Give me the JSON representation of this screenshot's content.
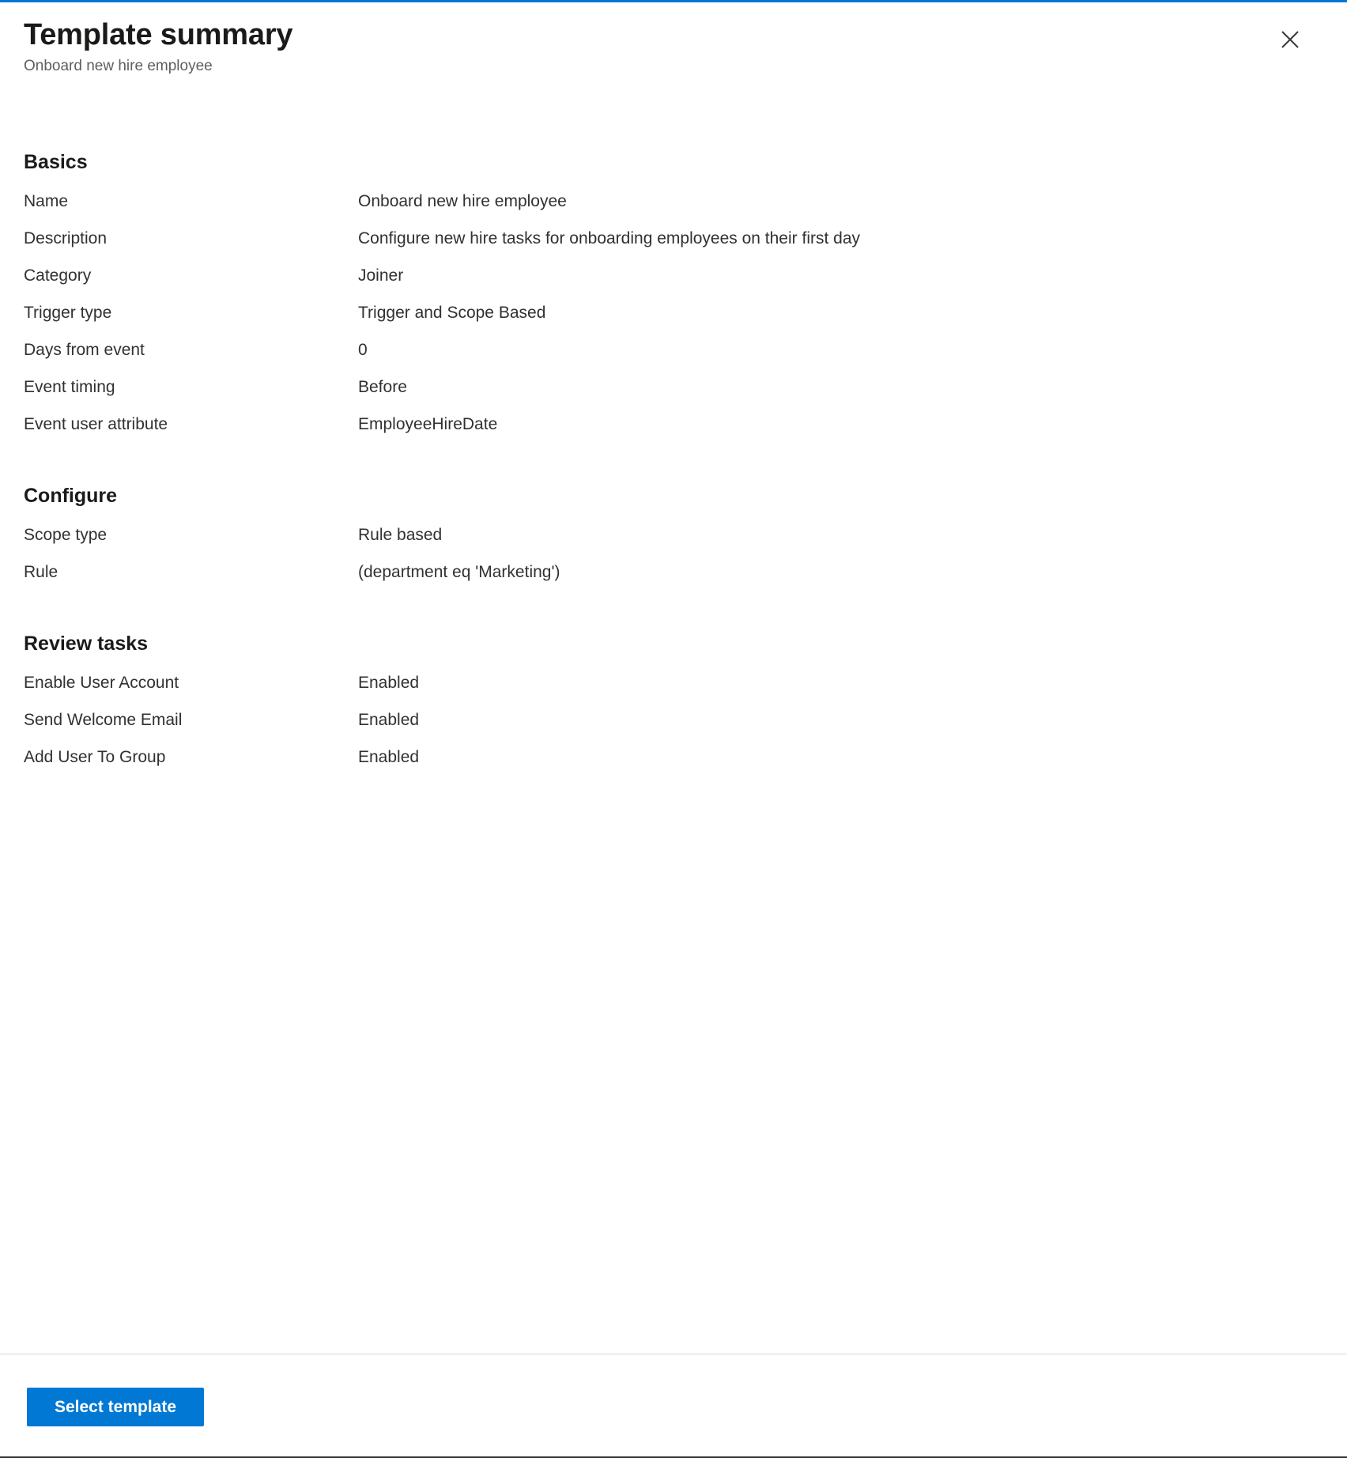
{
  "header": {
    "title": "Template summary",
    "subtitle": "Onboard new hire employee",
    "close_icon": "close-icon"
  },
  "sections": [
    {
      "title": "Basics",
      "rows": [
        {
          "label": "Name",
          "value": "Onboard new hire employee"
        },
        {
          "label": "Description",
          "value": "Configure new hire tasks for onboarding employees on their first day"
        },
        {
          "label": "Category",
          "value": "Joiner"
        },
        {
          "label": "Trigger type",
          "value": "Trigger and Scope Based"
        },
        {
          "label": "Days from event",
          "value": "0"
        },
        {
          "label": "Event timing",
          "value": "Before"
        },
        {
          "label": "Event user attribute",
          "value": "EmployeeHireDate"
        }
      ]
    },
    {
      "title": "Configure",
      "rows": [
        {
          "label": "Scope type",
          "value": "Rule based"
        },
        {
          "label": "Rule",
          "value": "(department eq 'Marketing')"
        }
      ]
    },
    {
      "title": "Review tasks",
      "rows": [
        {
          "label": "Enable User Account",
          "value": "Enabled"
        },
        {
          "label": "Send Welcome Email",
          "value": "Enabled"
        },
        {
          "label": "Add User To Group",
          "value": "Enabled"
        }
      ]
    }
  ],
  "footer": {
    "select_template_label": "Select template"
  },
  "colors": {
    "accent": "#0078d4",
    "text": "#323130",
    "muted_text": "#605e5c",
    "heading": "#1b1a19",
    "divider": "#d6d6d6"
  }
}
